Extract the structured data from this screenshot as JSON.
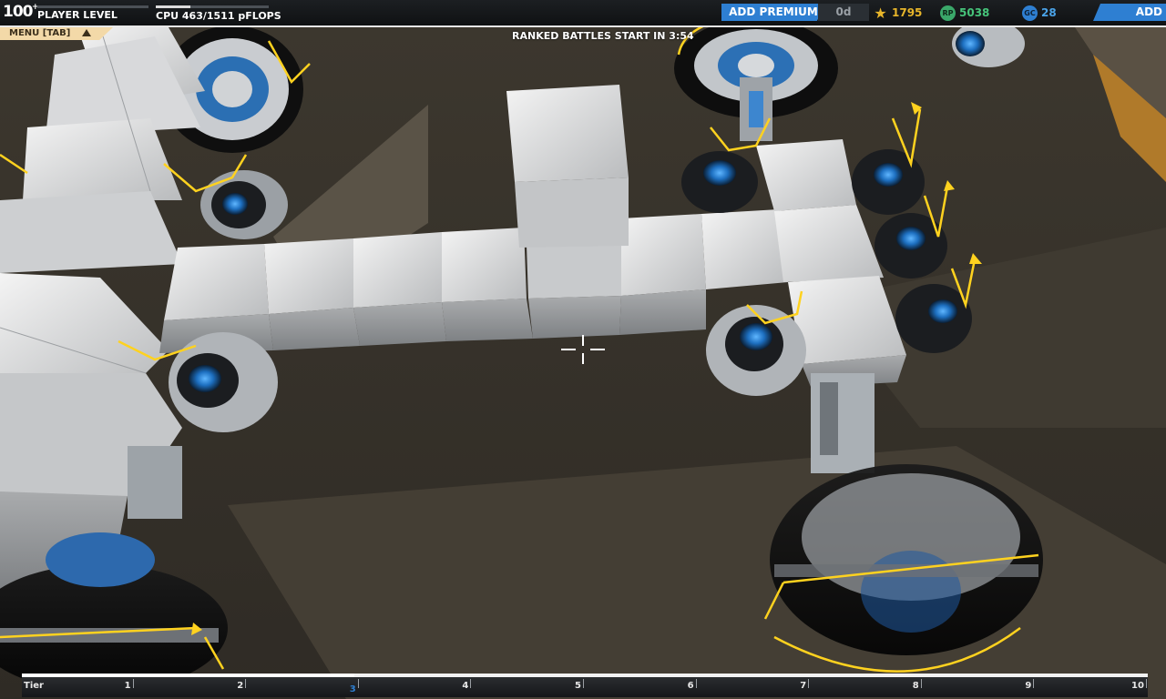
{
  "hud": {
    "player_level": "100",
    "player_level_sup": "+",
    "player_level_label": "PLAYER LEVEL",
    "cpu_label": "CPU 463/1511 pFLOPS",
    "cpu_used": 463,
    "cpu_max": 1511,
    "add_premium_label": "ADD PREMIUM",
    "premium_days": "0d",
    "robits": "1795",
    "rp_icon": "RP",
    "tech_points": "5038",
    "gc_icon": "GC",
    "galaxy_coins": "28",
    "add_funds_label": "ADD FUNDS",
    "menu_label": "MENU [TAB]",
    "ranked_text": "RANKED BATTLES START IN 3:54"
  },
  "tier": {
    "label": "Tier",
    "ticks": [
      "1",
      "2",
      "3",
      "4",
      "5",
      "6",
      "7",
      "8",
      "9",
      "10"
    ],
    "current_tier": "3",
    "progress_fraction": 0.295
  },
  "colors": {
    "accent_blue": "#2e7fd2",
    "robits_gold": "#e7b52a",
    "rp_green": "#46c47a",
    "menu_tab": "#f3d9a8",
    "marker_yellow": "#ffd21f"
  },
  "icons": {
    "robits": "star-icon",
    "tech": "rp-icon",
    "galaxy": "gc-icon",
    "menu": "triangle-up-icon",
    "crosshair": "crosshair-icon"
  }
}
